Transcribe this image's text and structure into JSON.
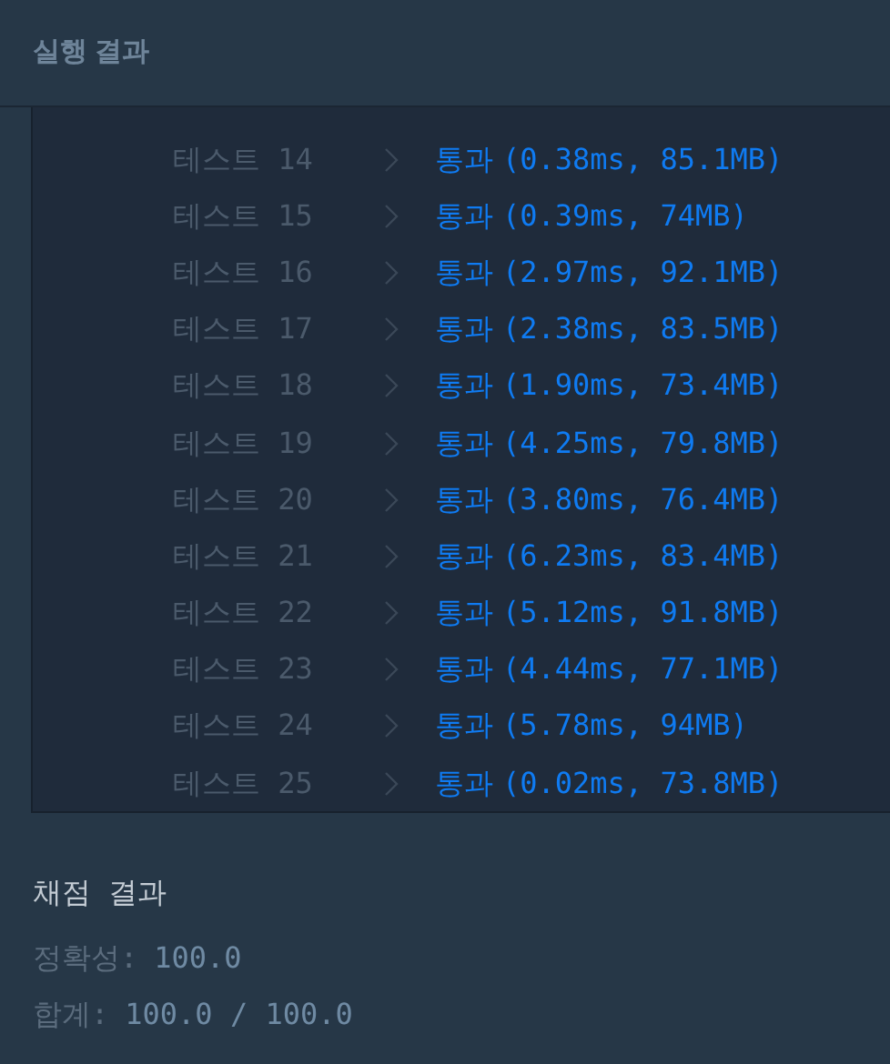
{
  "header": {
    "title": "실행 결과"
  },
  "tests": [
    {
      "label": "테스트 14",
      "result": "통과",
      "passed": true,
      "detail": "(0.38ms, 85.1MB)"
    },
    {
      "label": "테스트 15",
      "result": "통과",
      "passed": true,
      "detail": "(0.39ms, 74MB)"
    },
    {
      "label": "테스트 16",
      "result": "통과",
      "passed": true,
      "detail": "(2.97ms, 92.1MB)"
    },
    {
      "label": "테스트 17",
      "result": "통과",
      "passed": true,
      "detail": "(2.38ms, 83.5MB)"
    },
    {
      "label": "테스트 18",
      "result": "통과",
      "passed": true,
      "detail": "(1.90ms, 73.4MB)"
    },
    {
      "label": "테스트 19",
      "result": "통과",
      "passed": true,
      "detail": "(4.25ms, 79.8MB)"
    },
    {
      "label": "테스트 20",
      "result": "통과",
      "passed": true,
      "detail": "(3.80ms, 76.4MB)"
    },
    {
      "label": "테스트 21",
      "result": "통과",
      "passed": true,
      "detail": "(6.23ms, 83.4MB)"
    },
    {
      "label": "테스트 22",
      "result": "통과",
      "passed": true,
      "detail": "(5.12ms, 91.8MB)"
    },
    {
      "label": "테스트 23",
      "result": "통과",
      "passed": true,
      "detail": "(4.44ms, 77.1MB)"
    },
    {
      "label": "테스트 24",
      "result": "통과",
      "passed": true,
      "detail": "(5.78ms, 94MB)"
    },
    {
      "label": "테스트 25",
      "result": "통과",
      "passed": true,
      "detail": "(0.02ms, 73.8MB)"
    }
  ],
  "grading": {
    "title": "채점 결과",
    "lines": [
      {
        "label": "정확성:",
        "value": "100.0"
      },
      {
        "label": "합계:",
        "value": "100.0 / 100.0"
      }
    ]
  }
}
